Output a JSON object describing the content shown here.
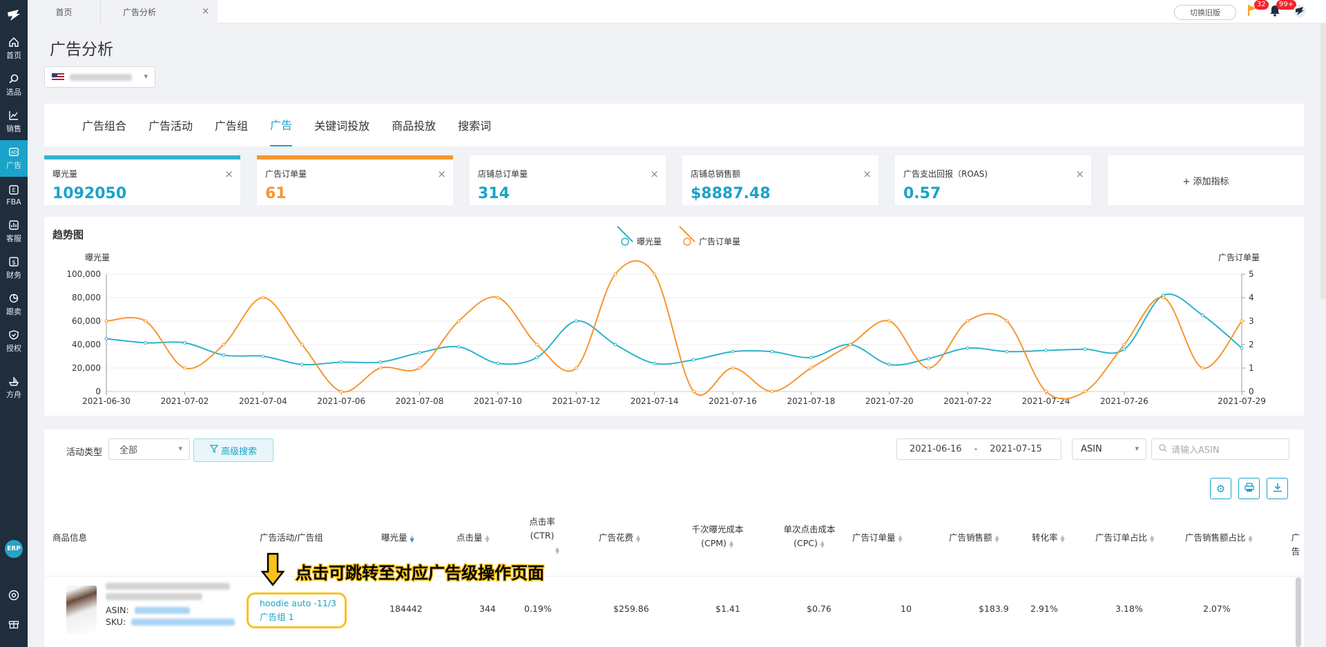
{
  "sidebar": {
    "items": [
      {
        "label": "首页",
        "icon": "home-icon"
      },
      {
        "label": "选品",
        "icon": "search-icon"
      },
      {
        "label": "销售",
        "icon": "chart-line-icon"
      },
      {
        "label": "广告",
        "icon": "ad-icon"
      },
      {
        "label": "FBA",
        "icon": "fba-icon"
      },
      {
        "label": "客服",
        "icon": "service-icon"
      },
      {
        "label": "财务",
        "icon": "dollar-icon"
      },
      {
        "label": "跟卖",
        "icon": "pie-icon"
      },
      {
        "label": "授权",
        "icon": "shield-icon"
      },
      {
        "label": "方舟",
        "icon": "ark-icon"
      }
    ],
    "erp": "ERP"
  },
  "topbar": {
    "tabs": [
      "首页",
      "广告分析"
    ],
    "close": "×",
    "old_version": "切换旧版",
    "flag_badge": "32",
    "bell_badge": "99+"
  },
  "page": {
    "title": "广告分析"
  },
  "subnav": [
    "广告组合",
    "广告活动",
    "广告组",
    "广告",
    "关键词投放",
    "商品投放",
    "搜索词"
  ],
  "metrics": [
    {
      "label": "曝光量",
      "value": "1092050"
    },
    {
      "label": "广告订单量",
      "value": "61"
    },
    {
      "label": "店铺总订单量",
      "value": "314"
    },
    {
      "label": "店铺总销售额",
      "value": "$8887.48"
    },
    {
      "label": "广告支出回报（ROAS)",
      "value": "0.57"
    }
  ],
  "add_metric": "+ 添加指标",
  "chart": {
    "title": "趋势图",
    "legend": [
      "曝光量",
      "广告订单量"
    ],
    "left_axis_label": "曝光量",
    "right_axis_label": "广告订单量"
  },
  "chart_data": {
    "type": "line",
    "x": [
      "2021-06-30",
      "2021-07-01",
      "2021-07-02",
      "2021-07-03",
      "2021-07-04",
      "2021-07-05",
      "2021-07-06",
      "2021-07-07",
      "2021-07-08",
      "2021-07-09",
      "2021-07-10",
      "2021-07-11",
      "2021-07-12",
      "2021-07-13",
      "2021-07-14",
      "2021-07-15",
      "2021-07-16",
      "2021-07-17",
      "2021-07-18",
      "2021-07-19",
      "2021-07-20",
      "2021-07-21",
      "2021-07-22",
      "2021-07-23",
      "2021-07-24",
      "2021-07-25",
      "2021-07-26",
      "2021-07-27",
      "2021-07-28",
      "2021-07-29"
    ],
    "x_ticks": [
      "2021-06-30",
      "2021-07-02",
      "2021-07-04",
      "2021-07-06",
      "2021-07-08",
      "2021-07-10",
      "2021-07-12",
      "2021-07-14",
      "2021-07-16",
      "2021-07-18",
      "2021-07-20",
      "2021-07-22",
      "2021-07-24",
      "2021-07-26",
      "2021-07-29"
    ],
    "y_left_ticks": [
      "0",
      "20,000",
      "40,000",
      "60,000",
      "80,000",
      "100,000"
    ],
    "y_right_ticks": [
      "0",
      "1",
      "2",
      "3",
      "4",
      "5"
    ],
    "ylim_left": [
      0,
      100000
    ],
    "ylim_right": [
      0,
      5
    ],
    "series": [
      {
        "name": "曝光量",
        "axis": "left",
        "color": "#2bb3cc",
        "values": [
          45000,
          41500,
          41500,
          31000,
          30000,
          23000,
          25000,
          25000,
          33000,
          38000,
          24000,
          29000,
          60000,
          40000,
          24000,
          27000,
          34000,
          34000,
          29000,
          40000,
          23000,
          28000,
          37000,
          34000,
          35000,
          36000,
          36000,
          82000,
          65000,
          37000
        ]
      },
      {
        "name": "广告订单量",
        "axis": "right",
        "color": "#f5962f",
        "values": [
          3,
          3,
          1,
          2,
          4,
          2,
          0,
          1,
          1,
          3,
          4,
          2,
          1,
          5,
          5,
          0,
          1,
          0,
          1,
          2,
          3,
          1,
          3,
          3,
          0,
          0,
          2,
          4,
          1,
          3
        ]
      }
    ]
  },
  "filters": {
    "activity_type_label": "活动类型",
    "activity_type_value": "全部",
    "advanced_search": "高级搜索",
    "date_from": "2021-06-16",
    "date_sep": "-",
    "date_to": "2021-07-15",
    "asin_select": "ASIN",
    "asin_placeholder": "请输入ASIN"
  },
  "table": {
    "headers": {
      "product": "商品信息",
      "campaign": "广告活动/广告组",
      "impressions": "曝光量",
      "clicks": "点击量",
      "ctr_1": "点击率",
      "ctr_2": "(CTR)",
      "spend": "广告花费",
      "cpm_1": "千次曝光成本",
      "cpm_2": "(CPM)",
      "cpc_1": "单次点击成本",
      "cpc_2": "(CPC)",
      "orders": "广告订单量",
      "sales": "广告销售额",
      "cvr": "转化率",
      "order_share": "广告订单占比",
      "sales_share": "广告销售额占比",
      "more": "广告"
    },
    "row": {
      "asin_label": "ASIN:",
      "sku_label": "SKU:",
      "campaign": "hoodie auto -11/3",
      "ad_group": "广告组 1",
      "impressions": "184442",
      "clicks": "344",
      "ctr": "0.19%",
      "spend": "$259.86",
      "cpm": "$1.41",
      "cpc": "$0.76",
      "orders": "10",
      "sales": "$183.9",
      "cvr": "2.91%",
      "order_share": "3.18%",
      "sales_share": "2.07%"
    }
  },
  "annotation": "点击可跳转至对应广告级操作页面"
}
